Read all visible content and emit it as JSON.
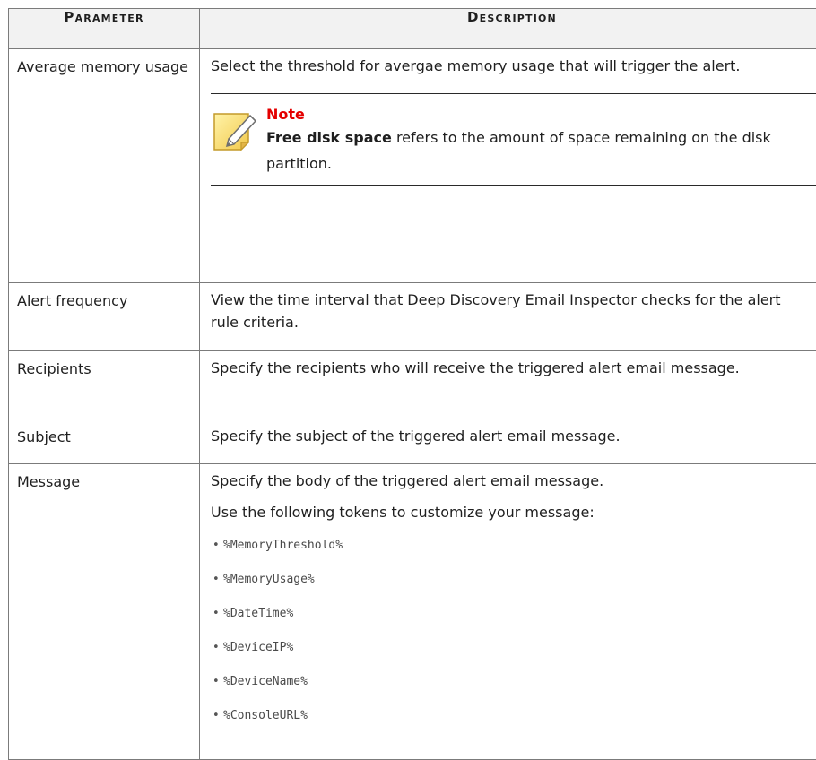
{
  "table": {
    "header": {
      "parameter": "Parameter",
      "description": "Description"
    },
    "rows": [
      {
        "param": "Average memory usage",
        "desc": "Select the threshold for avergae memory usage that will trigger the alert.",
        "note": {
          "title": "Note",
          "bold": "Free disk space",
          "text": " refers to the amount of space remaining on the disk partition."
        }
      },
      {
        "param": "Alert frequency",
        "desc": "View the time interval that Deep Discovery Email Inspector checks for the alert rule criteria."
      },
      {
        "param": "Recipients",
        "desc": "Specify the recipients who will receive the triggered alert email message."
      },
      {
        "param": "Subject",
        "desc": "Specify the subject of the triggered alert email message."
      },
      {
        "param": "Message",
        "desc": "Specify the body of the triggered alert email message.",
        "desc2": "Use the following tokens to customize your message:",
        "tokens": [
          "%MemoryThreshold%",
          "%MemoryUsage%",
          "%DateTime%",
          "%DeviceIP%",
          "%DeviceName%",
          "%ConsoleURL%"
        ]
      }
    ]
  },
  "icons": {
    "note": "note-pencil-icon"
  },
  "colors": {
    "note_title": "#e40000",
    "border": "#7b7b7b"
  }
}
